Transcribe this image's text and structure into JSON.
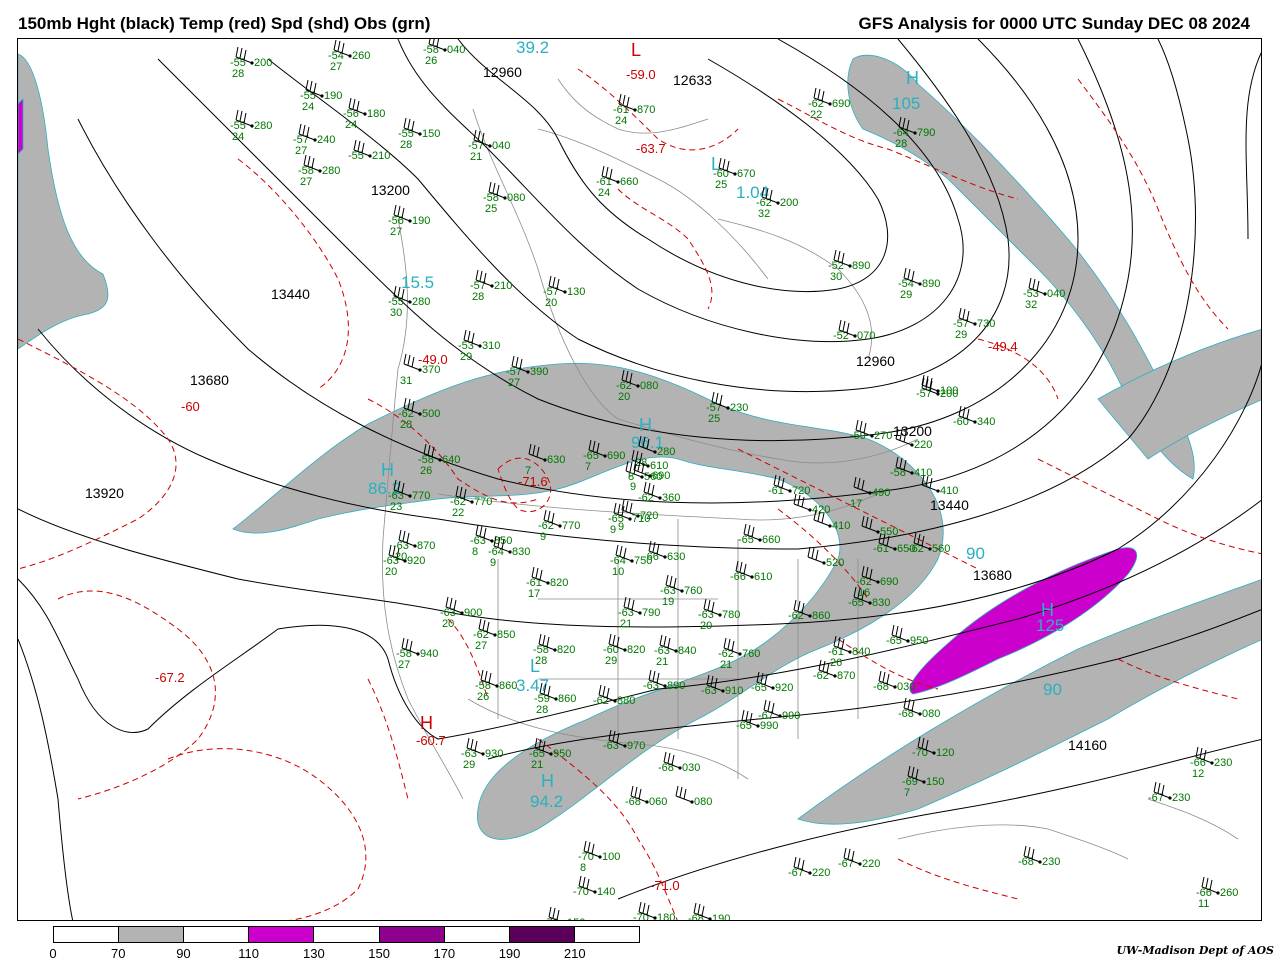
{
  "header": {
    "left_title": "150mb Hght (black) Temp (red) Spd (shd) Obs (grn)",
    "right_title": "GFS Analysis for 0000 UTC Sunday  DEC 08 2024"
  },
  "colors": {
    "height_contour": "#000000",
    "temp_contour": "#cc0000",
    "obs": "#007700",
    "speed_label": "#2ab0c0",
    "border": "#888888",
    "spd_70_90": "#b3b3b3",
    "spd_110_130": "#cc00cc",
    "spd_150_170": "#8e008e",
    "spd_190_210": "#5a005a"
  },
  "colorbar": {
    "ticks": [
      "0",
      "70",
      "90",
      "110",
      "130",
      "150",
      "170",
      "190",
      "210"
    ],
    "segments": [
      "#ffffff",
      "#b3b3b3",
      "#ffffff",
      "#cc00cc",
      "#ffffff",
      "#8e008e",
      "#ffffff",
      "#5a005a",
      "#ffffff"
    ]
  },
  "height_labels": [
    "12960",
    "12633",
    "13200",
    "13440",
    "13680",
    "13920",
    "12960",
    "13200",
    "13440",
    "13680",
    "14160"
  ],
  "temp_labels": [
    "-60",
    "-67.2",
    "-60.7",
    "-71.6",
    "-49.0",
    "-59.0",
    "-63.7",
    "-49.4",
    "-71.0"
  ],
  "speed_labels": [
    "39.2",
    "105",
    "15.5",
    "1.04",
    "96.1",
    "86.2",
    "90",
    "125",
    "90",
    "3.47",
    "94.2"
  ],
  "hl_symbols": [
    "H",
    "L",
    "L",
    "H",
    "H",
    "L",
    "H",
    "H",
    "H"
  ],
  "obs": [
    {
      "t": "-54",
      "d": "27",
      "h": "260"
    },
    {
      "t": "-58",
      "d": "26",
      "h": "040"
    },
    {
      "t": "-55",
      "d": "28",
      "h": "200"
    },
    {
      "t": "-55",
      "d": "24",
      "h": "190"
    },
    {
      "t": "-56",
      "d": "24",
      "h": "180"
    },
    {
      "t": "-55",
      "d": "24",
      "h": "280"
    },
    {
      "t": "-57",
      "d": "27",
      "h": "240"
    },
    {
      "t": "-55",
      "d": "28",
      "h": "150"
    },
    {
      "t": "-58",
      "d": "27",
      "h": "280"
    },
    {
      "t": "-55",
      "d": "",
      "h": "210"
    },
    {
      "t": "-57",
      "d": "21",
      "h": "040"
    },
    {
      "t": "-58",
      "d": "25",
      "h": "080"
    },
    {
      "t": "-56",
      "d": "27",
      "h": "190"
    },
    {
      "t": "-57",
      "d": "28",
      "h": "210"
    },
    {
      "t": "-57",
      "d": "20",
      "h": "130"
    },
    {
      "t": "-55",
      "d": "30",
      "h": "280"
    },
    {
      "t": "-53",
      "d": "29",
      "h": "310"
    },
    {
      "t": "",
      "d": "31",
      "h": "370"
    },
    {
      "t": "-57",
      "d": "27",
      "h": "390"
    },
    {
      "t": "-62",
      "d": "28",
      "h": "500"
    },
    {
      "t": "-58",
      "d": "26",
      "h": "640"
    },
    {
      "t": "-63",
      "d": "23",
      "h": "770"
    },
    {
      "t": "-62",
      "d": "22",
      "h": "770"
    },
    {
      "t": "",
      "d": "7",
      "h": "630"
    },
    {
      "t": "-65",
      "d": "7",
      "h": "690"
    },
    {
      "t": "",
      "d": "9",
      "h": "720"
    },
    {
      "t": "-62",
      "d": "9",
      "h": "770"
    },
    {
      "t": "-63",
      "d": "8",
      "h": "850"
    },
    {
      "t": "-64",
      "d": "9",
      "h": "830"
    },
    {
      "t": "-63",
      "d": "20",
      "h": "920"
    },
    {
      "t": "-63",
      "d": "20",
      "h": "870"
    },
    {
      "t": "-63",
      "d": "20",
      "h": "900"
    },
    {
      "t": "-61",
      "d": "17",
      "h": "820"
    },
    {
      "t": "-64",
      "d": "10",
      "h": "750"
    },
    {
      "t": "-63",
      "d": "19",
      "h": "760"
    },
    {
      "t": "-63",
      "d": "21",
      "h": "790"
    },
    {
      "t": "-63",
      "d": "20",
      "h": "780"
    },
    {
      "t": "-62",
      "d": "27",
      "h": "850"
    },
    {
      "t": "-58",
      "d": "27",
      "h": "940"
    },
    {
      "t": "-58",
      "d": "28",
      "h": "820"
    },
    {
      "t": "-60",
      "d": "29",
      "h": "820"
    },
    {
      "t": "-63",
      "d": "21",
      "h": "840"
    },
    {
      "t": "-58",
      "d": "26",
      "h": "860"
    },
    {
      "t": "-59",
      "d": "28",
      "h": "860"
    },
    {
      "t": "-62",
      "d": "",
      "h": "880"
    },
    {
      "t": "-63",
      "d": "",
      "h": "890"
    },
    {
      "t": "-63",
      "d": "",
      "h": "910"
    },
    {
      "t": "-65",
      "d": "",
      "h": "920"
    },
    {
      "t": "-65",
      "d": "",
      "h": "990"
    },
    {
      "t": "-67",
      "d": "",
      "h": "990"
    },
    {
      "t": "-63",
      "d": "29",
      "h": "930"
    },
    {
      "t": "-65",
      "d": "21",
      "h": "950"
    },
    {
      "t": "-63",
      "d": "",
      "h": "970"
    },
    {
      "t": "-68",
      "d": "",
      "h": "030"
    },
    {
      "t": "-68",
      "d": "",
      "h": "060"
    },
    {
      "t": "",
      "d": "",
      "h": "080"
    },
    {
      "t": "-70",
      "d": "8",
      "h": "100"
    },
    {
      "t": "-70",
      "d": "",
      "h": "140"
    },
    {
      "t": "-70",
      "d": "",
      "h": "150"
    },
    {
      "t": "-70",
      "d": "",
      "h": "180"
    },
    {
      "t": "-68",
      "d": "",
      "h": "190"
    },
    {
      "t": "-67",
      "d": "",
      "h": "220"
    },
    {
      "t": "-67",
      "d": "",
      "h": "220"
    },
    {
      "t": "-68",
      "d": "",
      "h": "230"
    },
    {
      "t": "-66",
      "d": "12",
      "h": "230"
    },
    {
      "t": "-67",
      "d": "",
      "h": "230"
    },
    {
      "t": "-66",
      "d": "11",
      "h": "260"
    },
    {
      "t": "-69",
      "d": "7",
      "h": "150"
    },
    {
      "t": "-70",
      "d": "",
      "h": "120"
    },
    {
      "t": "-68",
      "d": "",
      "h": "080"
    },
    {
      "t": "-68",
      "d": "",
      "h": "030"
    },
    {
      "t": "-65",
      "d": "",
      "h": "950"
    },
    {
      "t": "-61",
      "d": "26",
      "h": "840"
    },
    {
      "t": "-62",
      "d": "",
      "h": "860"
    },
    {
      "t": "-62",
      "d": "",
      "h": "870"
    },
    {
      "t": "-62",
      "d": "21",
      "h": "760"
    },
    {
      "t": "-65",
      "d": "",
      "h": "830"
    },
    {
      "t": "-62",
      "d": "16",
      "h": "690"
    },
    {
      "t": "-61",
      "d": "",
      "h": "650"
    },
    {
      "t": "-62",
      "d": "",
      "h": "560"
    },
    {
      "t": "",
      "d": "",
      "h": "550"
    },
    {
      "t": "",
      "d": "",
      "h": "520"
    },
    {
      "t": "-66",
      "d": "",
      "h": "610"
    },
    {
      "t": "-65",
      "d": "",
      "h": "660"
    },
    {
      "t": "-66",
      "d": "",
      "h": "630"
    },
    {
      "t": "-65",
      "d": "9",
      "h": "710"
    },
    {
      "t": "-61",
      "d": "",
      "h": "720"
    },
    {
      "t": "",
      "d": "",
      "h": "420"
    },
    {
      "t": "",
      "d": "",
      "h": "410"
    },
    {
      "t": "",
      "d": "17",
      "h": "490"
    },
    {
      "t": "",
      "d": "",
      "h": "410"
    },
    {
      "t": "-58",
      "d": "",
      "h": "410"
    },
    {
      "t": "-60",
      "d": "",
      "h": "340"
    },
    {
      "t": "",
      "d": "",
      "h": "220"
    },
    {
      "t": "-59",
      "d": "",
      "h": "270"
    },
    {
      "t": "-57",
      "d": "25",
      "h": "230"
    },
    {
      "t": "-57",
      "d": "",
      "h": "200"
    },
    {
      "t": "",
      "d": "",
      "h": "100"
    },
    {
      "t": "-52",
      "d": "",
      "h": "070"
    },
    {
      "t": "-54",
      "d": "29",
      "h": "890"
    },
    {
      "t": "-52",
      "d": "30",
      "h": "890"
    },
    {
      "t": "-57",
      "d": "29",
      "h": "730"
    },
    {
      "t": "-53",
      "d": "32",
      "h": "040"
    },
    {
      "t": "-62",
      "d": "32",
      "h": "200"
    },
    {
      "t": "-60",
      "d": "25",
      "h": "670"
    },
    {
      "t": "-61",
      "d": "24",
      "h": "660"
    },
    {
      "t": "-61",
      "d": "24",
      "h": "870"
    },
    {
      "t": "-62",
      "d": "22",
      "h": "690"
    },
    {
      "t": "-64",
      "d": "28",
      "h": "790"
    },
    {
      "t": "-62",
      "d": "20",
      "h": "080"
    },
    {
      "t": "",
      "d": "28",
      "h": "280"
    },
    {
      "t": "-62",
      "d": "",
      "h": "360"
    },
    {
      "t": "",
      "d": "",
      "h": "560"
    },
    {
      "t": "",
      "d": "8",
      "h": "610"
    },
    {
      "t": "-",
      "d": "9",
      "h": "690"
    },
    {
      "t": "",
      "d": "",
      "h": "600"
    }
  ],
  "credit": "UW-Madison   Dept of AOS"
}
